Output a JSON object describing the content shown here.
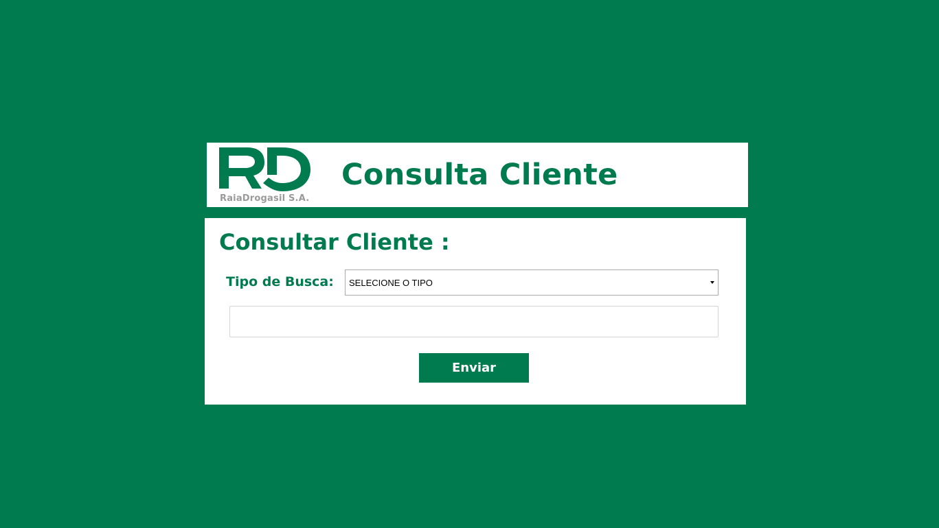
{
  "colors": {
    "background": "#007a4f",
    "brand_green": "#007a4f",
    "logo_caption_gray": "#9a9a9a"
  },
  "header": {
    "logo_caption": "RaiaDrogasil S.A.",
    "title": "Consulta Cliente"
  },
  "form": {
    "section_title": "Consultar Cliente :",
    "search_type_label": "Tipo de Busca:",
    "search_type_selected": "SELECIONE O TIPO",
    "search_value": "",
    "submit_label": "Enviar"
  }
}
